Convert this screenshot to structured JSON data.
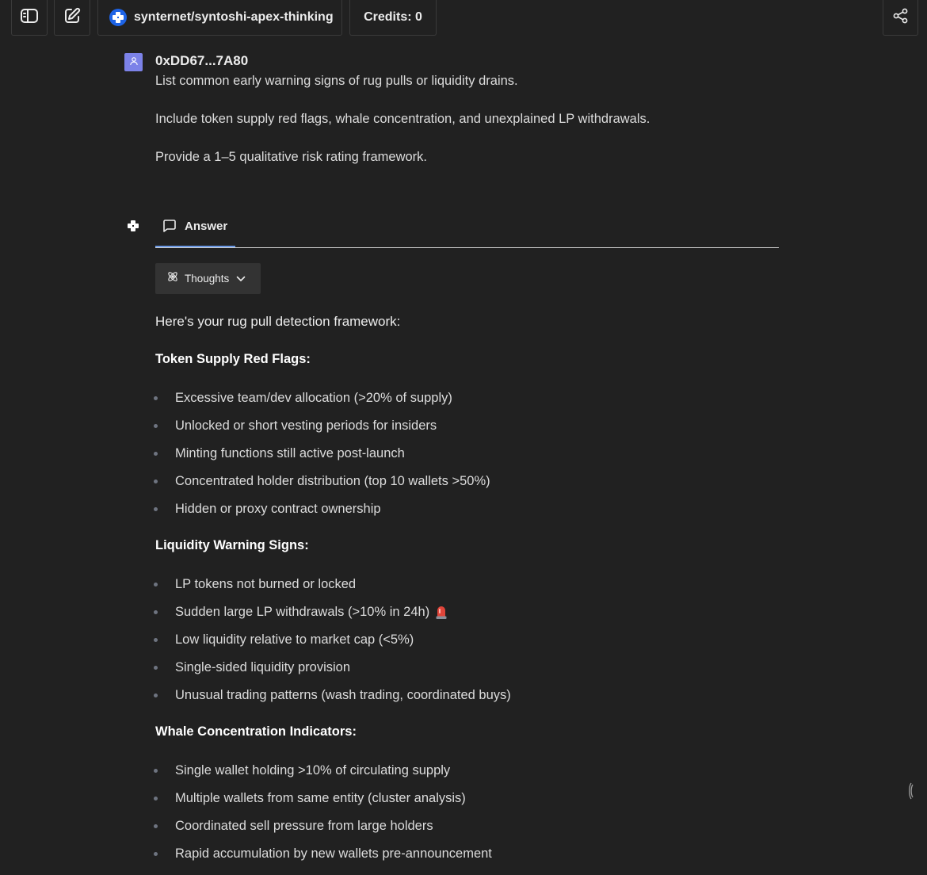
{
  "topbar": {
    "model_name": "synternet/syntoshi-apex-thinking",
    "credits_label": "Credits: 0"
  },
  "user_message": {
    "author": "0xDD67...7A80",
    "lines": [
      "List common early warning signs of rug pulls or liquidity drains.",
      "Include token supply red flags, whale concentration, and unexplained LP withdrawals.",
      "Provide a 1–5 qualitative risk rating framework."
    ]
  },
  "answer": {
    "tab_label": "Answer",
    "thoughts_label": "Thoughts",
    "intro": "Here's your rug pull detection framework:",
    "sections": [
      {
        "heading": "Token Supply Red Flags:",
        "items": [
          "Excessive team/dev allocation (>20% of supply)",
          "Unlocked or short vesting periods for insiders",
          "Minting functions still active post-launch",
          "Concentrated holder distribution (top 10 wallets >50%)",
          "Hidden or proxy contract ownership"
        ]
      },
      {
        "heading": "Liquidity Warning Signs:",
        "items": [
          "LP tokens not burned or locked",
          "Sudden large LP withdrawals (>10% in 24h)",
          "Low liquidity relative to market cap (<5%)",
          "Single-sided liquidity provision",
          "Unusual trading patterns (wash trading, coordinated buys)"
        ]
      },
      {
        "heading": "Whale Concentration Indicators:",
        "items": [
          "Single wallet holding >10% of circulating supply",
          "Multiple wallets from same entity (cluster analysis)",
          "Coordinated sell pressure from large holders",
          "Rapid accumulation by new wallets pre-announcement"
        ]
      }
    ]
  },
  "icons": {
    "sidebar_toggle": "sidebar-toggle-icon",
    "new_chat": "edit-icon",
    "share": "share-icon",
    "siren": "police-light-emoji"
  },
  "colors": {
    "background": "#212121",
    "brand_blue": "#1d63e6",
    "tab_underline": "#6a98e6",
    "user_avatar": "#7c82e8"
  }
}
